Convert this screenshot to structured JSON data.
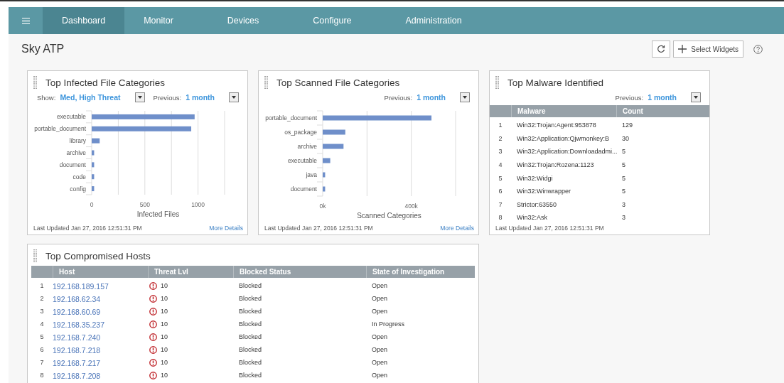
{
  "nav": {
    "tabs": [
      {
        "label": "Dashboard",
        "selected": true
      },
      {
        "label": "Monitor",
        "selected": false
      },
      {
        "label": "Devices",
        "selected": false
      },
      {
        "label": "Configure",
        "selected": false
      },
      {
        "label": "Administration",
        "selected": false
      }
    ]
  },
  "page": {
    "title": "Sky ATP",
    "select_widgets": "Select Widgets"
  },
  "widgets": [
    {
      "kind": "chart",
      "title": "Top Infected File Categories",
      "filters": [
        {
          "label": "Show:",
          "value": "Med, High Threat"
        },
        {
          "label": "Previous:",
          "value": "1 month"
        }
      ],
      "chart_data": {
        "type": "bar",
        "orientation": "horizontal",
        "xlabel": "Infected Files",
        "categories": [
          "executable",
          "portable_document",
          "library",
          "archive",
          "document",
          "code",
          "config"
        ],
        "values": [
          968,
          936,
          75,
          23,
          23,
          23,
          23
        ],
        "xlim": [
          0,
          1250
        ],
        "xticks": [
          0,
          500,
          1000
        ]
      },
      "updated": "Last Updated Jan 27, 2016 12:51:31 PM",
      "more": "More Details"
    },
    {
      "kind": "chart",
      "title": "Top Scanned File Categories",
      "filters": [
        {
          "label": "Previous:",
          "value": "1 month"
        }
      ],
      "chart_data": {
        "type": "bar",
        "orientation": "horizontal",
        "xlabel": "Scanned Categories",
        "categories": [
          "portable_document",
          "os_package",
          "archive",
          "executable",
          "java",
          "document"
        ],
        "values": [
          491000,
          102000,
          94000,
          34000,
          11000,
          11000
        ],
        "xlim": [
          0,
          600000
        ],
        "xticks": [
          {
            "value": 0,
            "label": "0k"
          },
          {
            "value": 400000,
            "label": "400k"
          }
        ]
      },
      "updated": "Last Updated Jan 27, 2016 12:51:31 PM",
      "more": "More Details"
    },
    {
      "kind": "table",
      "title": "Top Malware Identified",
      "filters": [
        {
          "label": "Previous:",
          "value": "1 month"
        }
      ],
      "columns": [
        "Malware",
        "Count"
      ],
      "rows": [
        {
          "index": "1",
          "cells": [
            "Win32:Trojan:Agent:953878",
            "129"
          ]
        },
        {
          "index": "2",
          "cells": [
            "Win32:Application:Qjwmonkey:B",
            "30"
          ]
        },
        {
          "index": "3",
          "cells": [
            "Win32:Application:Downloadadmi...",
            "5"
          ]
        },
        {
          "index": "4",
          "cells": [
            "Win32:Trojan:Rozena:1123",
            "5"
          ]
        },
        {
          "index": "5",
          "cells": [
            "Win32:Widgi",
            "5"
          ]
        },
        {
          "index": "6",
          "cells": [
            "Win32:Winwrapper",
            "5"
          ]
        },
        {
          "index": "7",
          "cells": [
            "Strictor:63550",
            "3"
          ]
        },
        {
          "index": "8",
          "cells": [
            "Win32:Ask",
            "3"
          ]
        }
      ],
      "updated": "Last Updated Jan 27, 2016 12:51:31 PM"
    }
  ],
  "hosts": {
    "title": "Top Compromised Hosts",
    "columns": [
      "Host",
      "Threat Lvl",
      "Blocked Status",
      "State of Investigation"
    ],
    "rows": [
      {
        "index": "1",
        "host": "192.168.189.157",
        "threat": "10",
        "blocked": "Blocked",
        "state": "Open"
      },
      {
        "index": "2",
        "host": "192.168.62.34",
        "threat": "10",
        "blocked": "Blocked",
        "state": "Open"
      },
      {
        "index": "3",
        "host": "192.168.60.69",
        "threat": "10",
        "blocked": "Blocked",
        "state": "Open"
      },
      {
        "index": "4",
        "host": "192.168.35.237",
        "threat": "10",
        "blocked": "Blocked",
        "state": "In Progress"
      },
      {
        "index": "5",
        "host": "192.168.7.240",
        "threat": "10",
        "blocked": "Blocked",
        "state": "Open"
      },
      {
        "index": "6",
        "host": "192.168.7.218",
        "threat": "10",
        "blocked": "Blocked",
        "state": "Open"
      },
      {
        "index": "7",
        "host": "192.168.7.217",
        "threat": "10",
        "blocked": "Blocked",
        "state": "Open"
      },
      {
        "index": "8",
        "host": "192.168.7.208",
        "threat": "10",
        "blocked": "Blocked",
        "state": "Open"
      }
    ]
  }
}
